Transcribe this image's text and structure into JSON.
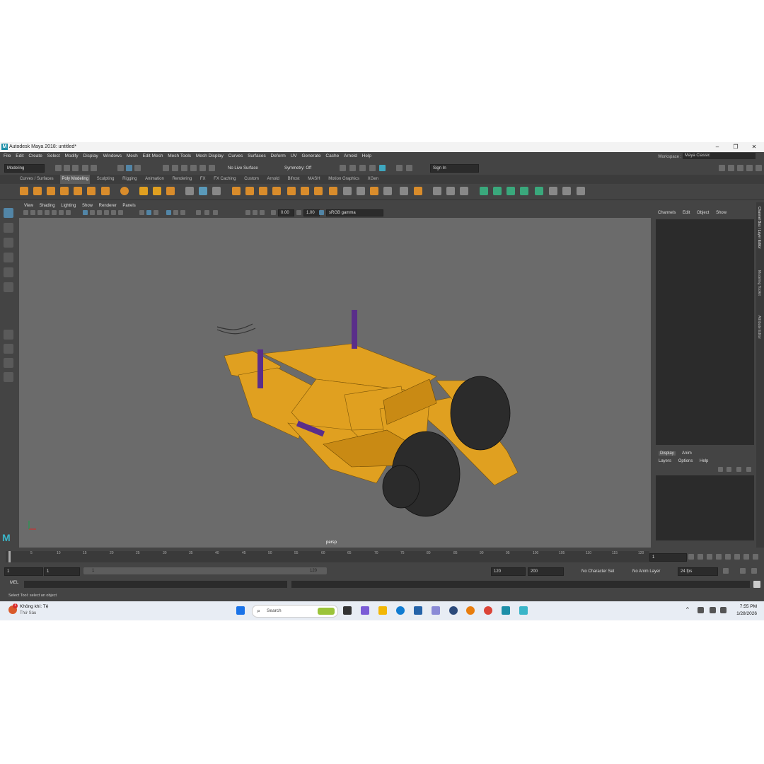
{
  "window": {
    "title": "Autodesk Maya 2018: untitled*",
    "logo": "M",
    "min": "–",
    "max": "❐",
    "close": "✕"
  },
  "menu": {
    "items": [
      "File",
      "Edit",
      "Create",
      "Select",
      "Modify",
      "Display",
      "Windows",
      "Mesh",
      "Edit Mesh",
      "Mesh Tools",
      "Mesh Display",
      "Curves",
      "Surfaces",
      "Deform",
      "UV",
      "Generate",
      "Cache",
      "Arnold",
      "Help"
    ]
  },
  "workspace": {
    "label": "Workspace :",
    "value": "Maya Classic"
  },
  "statusline": {
    "mode": "Modeling",
    "live_surface": "No Live Surface",
    "symmetry": "Symmetry: Off",
    "sign_in": "Sign In"
  },
  "shelf": {
    "tabs": [
      "Curves / Surfaces",
      "Poly Modeling",
      "Sculpting",
      "Rigging",
      "Animation",
      "Rendering",
      "FX",
      "FX Caching",
      "Custom",
      "Arnold",
      "Bifrost",
      "MASH",
      "Motion Graphics",
      "XGen"
    ],
    "active": "Poly Modeling"
  },
  "viewport": {
    "menus": [
      "View",
      "Shading",
      "Lighting",
      "Show",
      "Renderer",
      "Panels"
    ],
    "field1": "0.00",
    "field2": "1.00",
    "colorspace": "sRGB gamma",
    "camera": "persp"
  },
  "channelbox": {
    "tabs": [
      "Channels",
      "Edit",
      "Object",
      "Show"
    ]
  },
  "layereditor": {
    "tabs": [
      "Display",
      "Anim"
    ],
    "menus": [
      "Layers",
      "Options",
      "Help"
    ]
  },
  "sidetabs": [
    "Channel Box / Layer Editor",
    "Modeling Toolkit",
    "Attribute Editor"
  ],
  "timeline": {
    "ticks": [
      "5",
      "10",
      "15",
      "20",
      "25",
      "30",
      "35",
      "40",
      "45",
      "50",
      "55",
      "60",
      "65",
      "70",
      "75",
      "80",
      "85",
      "90",
      "95",
      "100",
      "105",
      "110",
      "115",
      "120"
    ],
    "current": "1"
  },
  "range": {
    "start": "1",
    "start2": "1",
    "slider_start": "1",
    "slider_end": "120",
    "end": "120",
    "end2": "200",
    "char_set": "No Character Set",
    "anim_layer": "No Anim Layer",
    "fps": "24 fps"
  },
  "cmdline": {
    "label": "MEL"
  },
  "helpline": {
    "text": "Select Tool: select an object"
  },
  "taskbar": {
    "weather_title": "Không khí: Tệ",
    "weather_sub": "Thứ Sáu",
    "weather_badge": "1",
    "search": "Search",
    "time": "7:55 PM",
    "date": "1/28/2026"
  },
  "colors": {
    "maya_bg": "#444444",
    "viewport_bg": "#6b6b6b",
    "model_yellow": "#e0a020",
    "accent_blue": "#5285a6"
  }
}
